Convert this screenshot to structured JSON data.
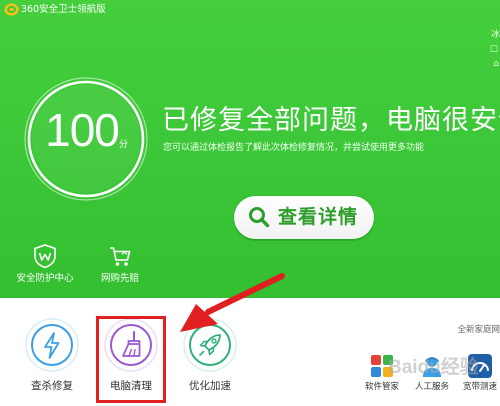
{
  "app": {
    "title": "360安全卫士领航版",
    "logo_icon": "360-shield-logo-icon"
  },
  "right_edge": [
    "冰",
    "☐",
    "⌂"
  ],
  "score": {
    "value": "100",
    "unit": "分"
  },
  "headline": "已修复全部问题，电脑很安全",
  "subline": "您可以通过体检报告了解此次体检修复情况，并尝试使用更多功能",
  "details_button": {
    "label": "查看详情",
    "icon": "magnifier-icon"
  },
  "quick_links": [
    {
      "label": "安全防护中心",
      "icon": "shield-w-icon"
    },
    {
      "label": "网购先赔",
      "icon": "shopping-cart-icon"
    }
  ],
  "tools": [
    {
      "label": "查杀修复",
      "icon": "lightning-icon",
      "color": "#3aa0e6"
    },
    {
      "label": "电脑清理",
      "icon": "broom-icon",
      "color": "#9b59d0"
    },
    {
      "label": "优化加速",
      "icon": "rocket-icon",
      "color": "#2fb07a"
    }
  ],
  "family_label": "全新家庭网",
  "services": [
    {
      "label": "软件管家",
      "icon": "software-grid-icon"
    },
    {
      "label": "人工服务",
      "icon": "person-service-icon"
    },
    {
      "label": "宽带测速",
      "icon": "speedometer-icon"
    }
  ],
  "watermark": "Baidu经验",
  "colors": {
    "brand_green": "#3cc838",
    "highlight_red": "#e02020",
    "button_text_green": "#2e9e2a"
  }
}
